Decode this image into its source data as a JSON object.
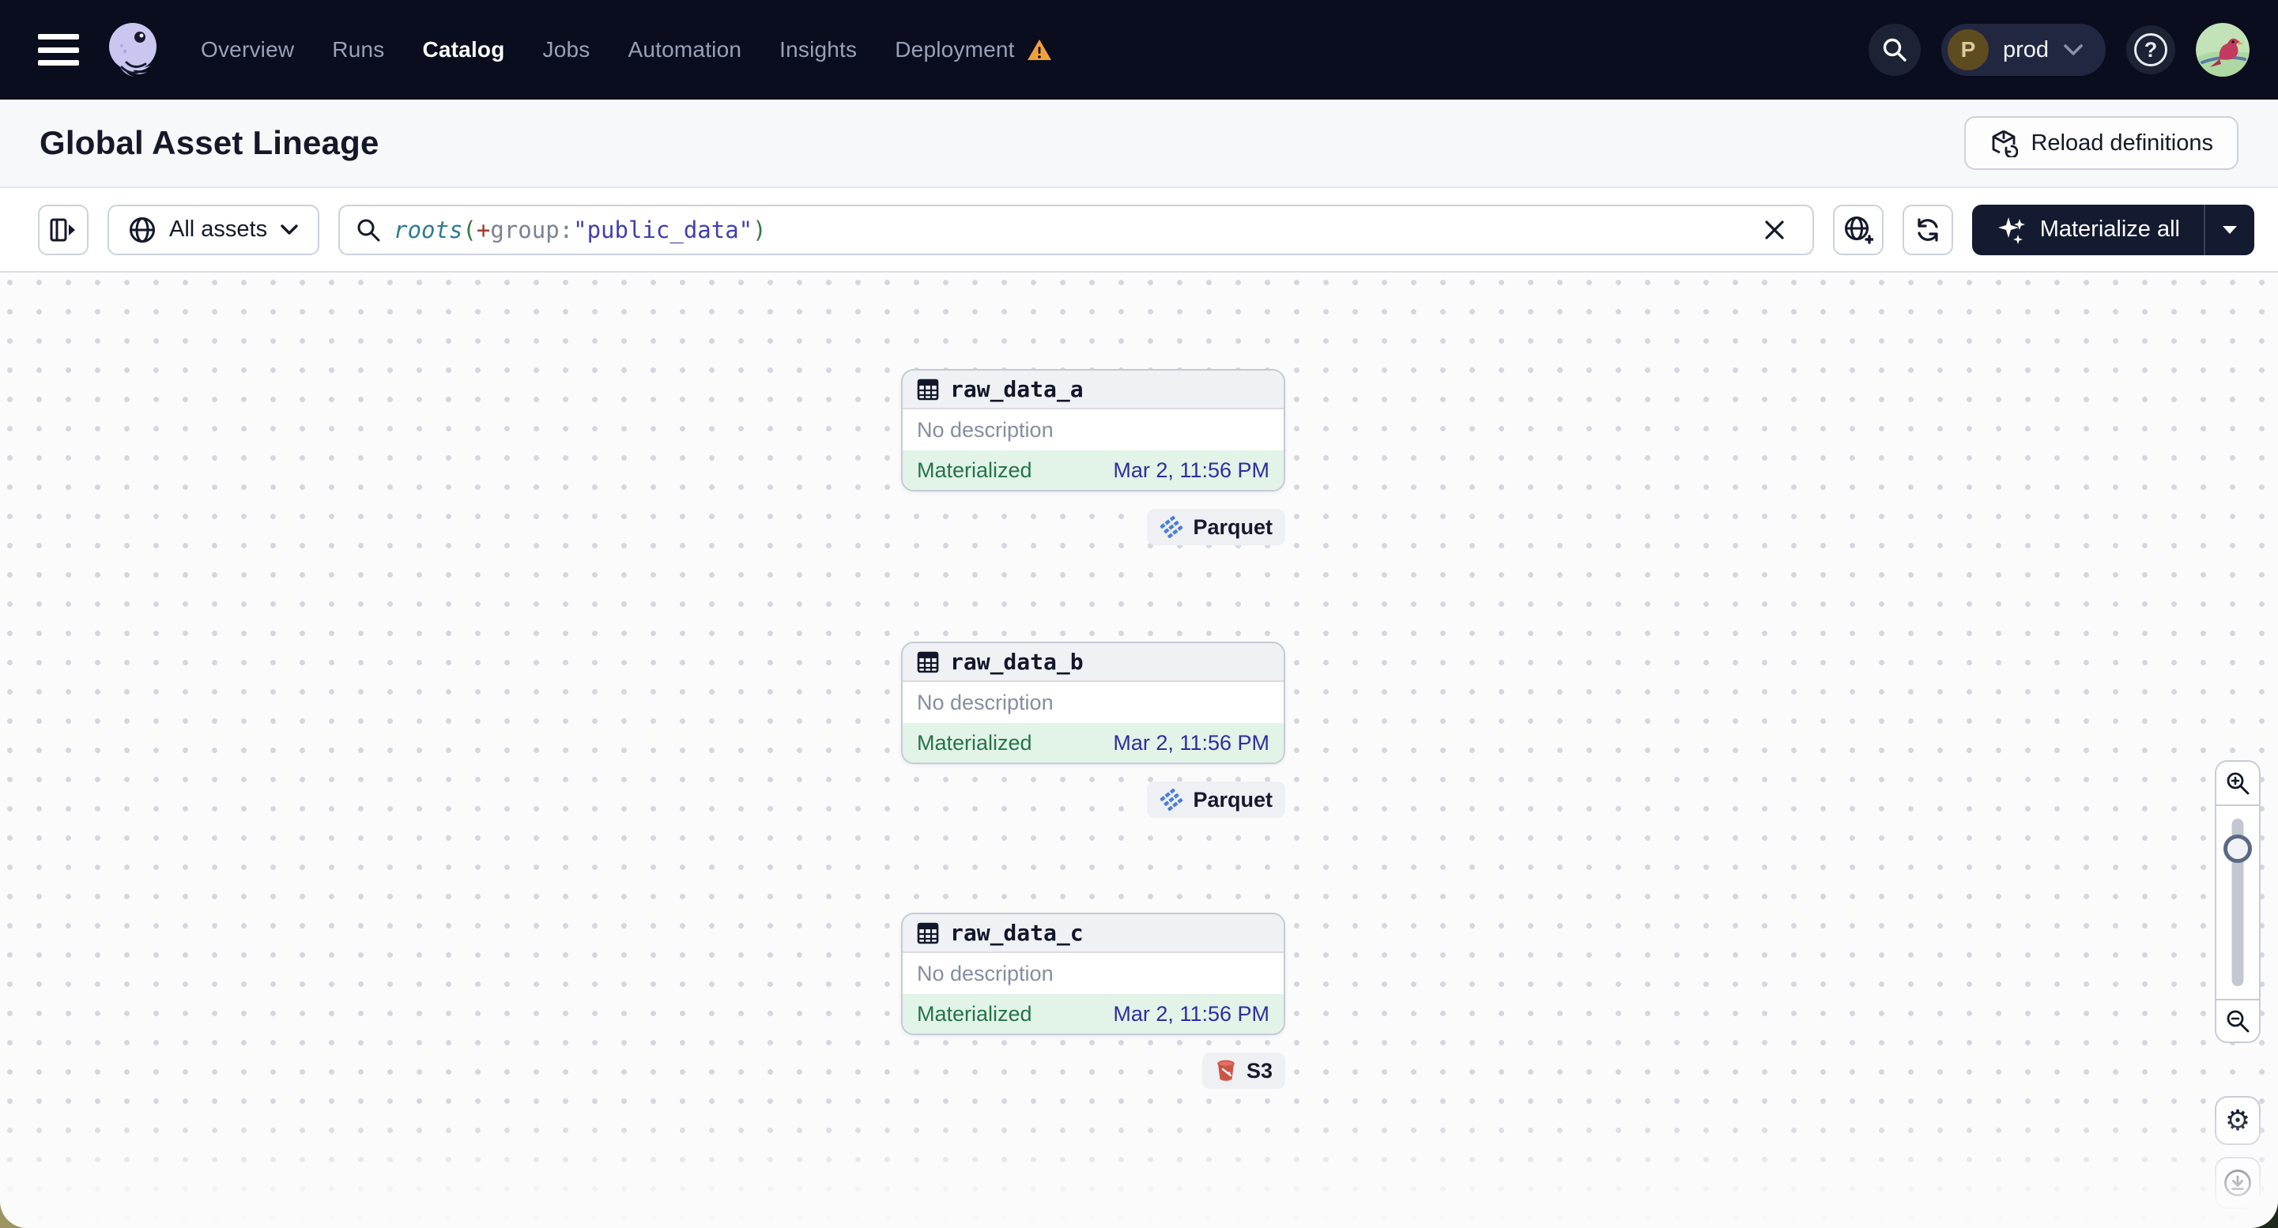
{
  "nav": {
    "items": [
      {
        "label": "Overview",
        "active": false
      },
      {
        "label": "Runs",
        "active": false
      },
      {
        "label": "Catalog",
        "active": true
      },
      {
        "label": "Jobs",
        "active": false
      },
      {
        "label": "Automation",
        "active": false
      },
      {
        "label": "Insights",
        "active": false
      },
      {
        "label": "Deployment",
        "active": false,
        "warning": true
      }
    ],
    "environment": {
      "initial": "P",
      "name": "prod"
    }
  },
  "header": {
    "title": "Global Asset Lineage",
    "reload_label": "Reload definitions"
  },
  "toolbar": {
    "scope_label": "All assets",
    "query": {
      "fn": "roots",
      "open_paren": "(",
      "plus": "+",
      "key": "group",
      "colon": ":",
      "value": "\"public_data\"",
      "close_paren": ")"
    },
    "materialize_label": "Materialize all"
  },
  "canvas": {
    "nodes": [
      {
        "name": "raw_data_a",
        "description": "No description",
        "status": "Materialized",
        "timestamp": "Mar 2, 11:56 PM",
        "tag": "Parquet",
        "tag_icon": "parquet-icon"
      },
      {
        "name": "raw_data_b",
        "description": "No description",
        "status": "Materialized",
        "timestamp": "Mar 2, 11:56 PM",
        "tag": "Parquet",
        "tag_icon": "parquet-icon"
      },
      {
        "name": "raw_data_c",
        "description": "No description",
        "status": "Materialized",
        "timestamp": "Mar 2, 11:56 PM",
        "tag": "S3",
        "tag_icon": "s3-bucket-icon"
      }
    ]
  },
  "controls": {
    "gear_glyph": "⚙"
  },
  "colors": {
    "nav_background": "#0a0d1d",
    "status_green": "#25734c",
    "status_green_bg": "#e2f3e8",
    "timestamp_blue": "#2d2f9c",
    "warning_orange": "#f0a03c",
    "parquet_blue": "#4b7fd6",
    "s3_red": "#cc5446",
    "accent_dark_button": "#141a30"
  }
}
